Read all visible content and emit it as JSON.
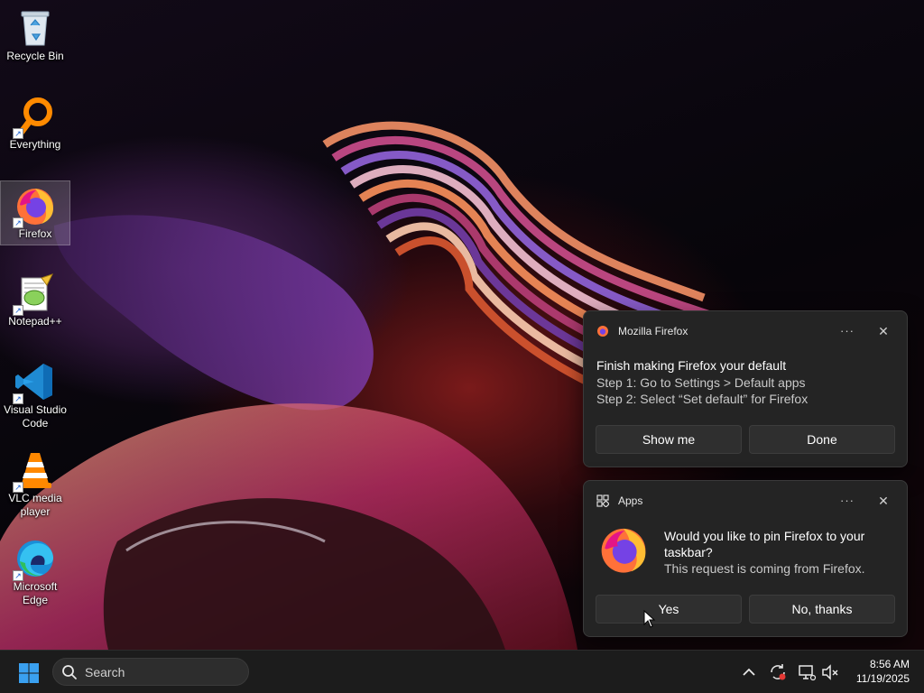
{
  "desktop": {
    "icons": [
      {
        "label": "Recycle Bin",
        "icon": "recycle-bin-icon"
      },
      {
        "label": "Everything",
        "icon": "everything-magnifier-icon"
      },
      {
        "label": "Firefox",
        "icon": "firefox-icon"
      },
      {
        "label": "Notepad++",
        "icon": "notepad-plus-plus-icon"
      },
      {
        "label": "Visual Studio Code",
        "icon": "vscode-icon"
      },
      {
        "label": "VLC media player",
        "icon": "vlc-icon"
      },
      {
        "label": "Microsoft Edge",
        "icon": "edge-icon"
      }
    ]
  },
  "toast_default": {
    "app_name": "Mozilla Firefox",
    "more": "···",
    "close": "✕",
    "title": "Finish making Firefox your default",
    "step1": "Step 1: Go to Settings > Default apps",
    "step2": "Step 2: Select “Set default” for Firefox",
    "btn_primary": "Show me",
    "btn_secondary": "Done"
  },
  "toast_pin": {
    "app_name": "Apps",
    "more": "···",
    "close": "✕",
    "question": "Would you like to pin Firefox to your taskbar?",
    "sub": "This request is coming from Firefox.",
    "btn_yes": "Yes",
    "btn_no": "No, thanks"
  },
  "taskbar": {
    "search_placeholder": "Search",
    "time": "8:56 AM",
    "date": "11/19/2025"
  },
  "colors": {
    "taskbar_bg": "#1c1c1c",
    "toast_bg": "#242424",
    "accent_blue": "#0078d4",
    "firefox_orange": "#ff7139"
  }
}
